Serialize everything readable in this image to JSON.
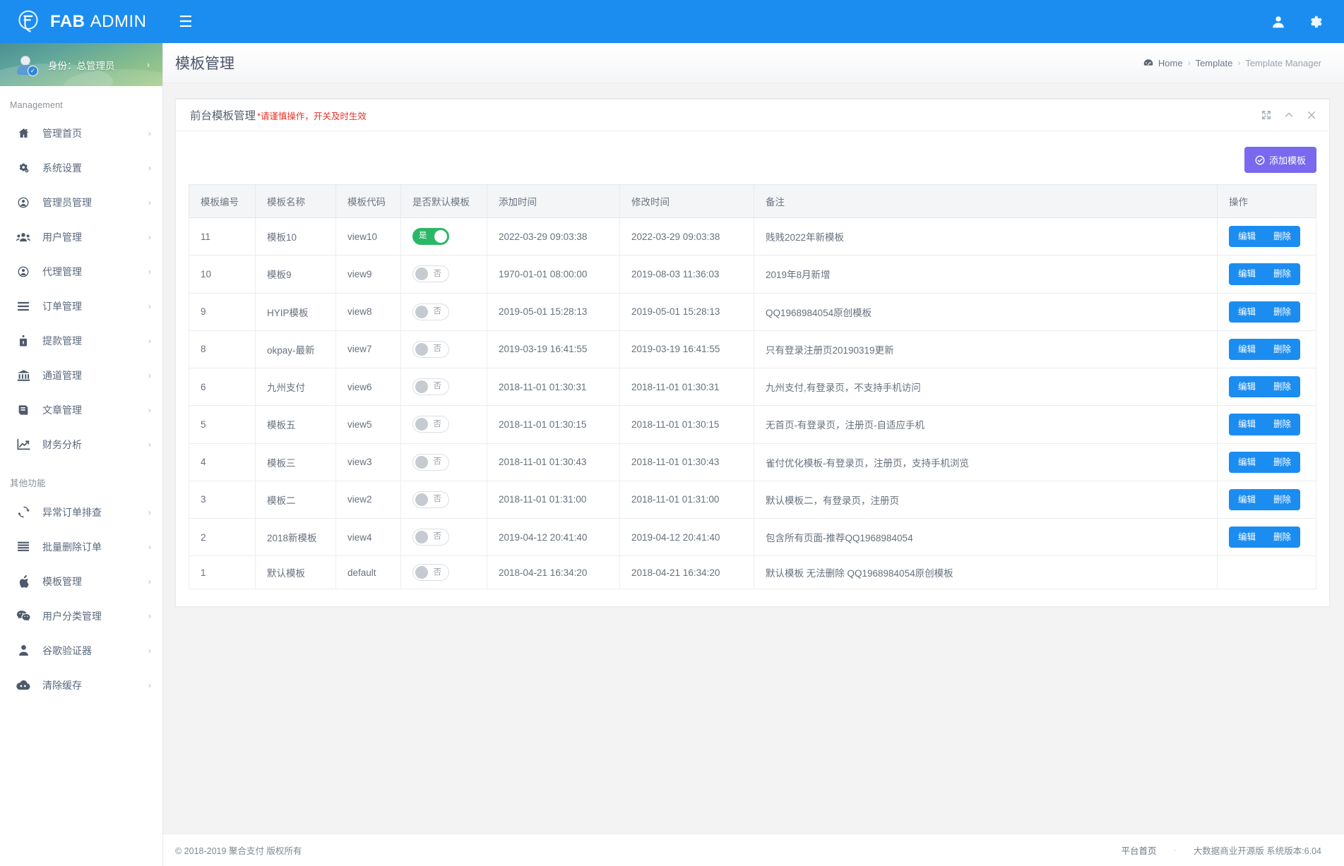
{
  "brand": {
    "bold": "FAB",
    "light": "ADMIN",
    "logo_icon": "fab-logo-icon"
  },
  "topbar": {
    "menu_toggle_icon": "hamburger-icon",
    "user_icon": "user-icon",
    "settings_icon": "gear-icon"
  },
  "sidebar": {
    "profile": {
      "label": "身份：总管理员",
      "avatar_icon": "avatar-icon",
      "check_icon": "check-badge-icon",
      "caret": "›"
    },
    "sections": [
      {
        "title": "Management",
        "items": [
          {
            "label": "管理首页",
            "icon": "home-icon",
            "caret": "›"
          },
          {
            "label": "系统设置",
            "icon": "gears-icon",
            "caret": "›"
          },
          {
            "label": "管理员管理",
            "icon": "user-circle-icon",
            "caret": "›"
          },
          {
            "label": "用户管理",
            "icon": "users-icon",
            "caret": "›"
          },
          {
            "label": "代理管理",
            "icon": "user-circle-icon",
            "caret": "›"
          },
          {
            "label": "订单管理",
            "icon": "list-icon",
            "caret": "›"
          },
          {
            "label": "提款管理",
            "icon": "lock-icon",
            "caret": "›"
          },
          {
            "label": "通道管理",
            "icon": "bank-icon",
            "caret": "›"
          },
          {
            "label": "文章管理",
            "icon": "book-icon",
            "caret": "›"
          },
          {
            "label": "财务分析",
            "icon": "chart-line-icon",
            "caret": "›"
          }
        ]
      },
      {
        "title": "其他功能",
        "items": [
          {
            "label": "异常订单排查",
            "icon": "refresh-icon",
            "caret": "›"
          },
          {
            "label": "批量删除订单",
            "icon": "list-icon",
            "caret": "›"
          },
          {
            "label": "模板管理",
            "icon": "apple-icon",
            "caret": "›"
          },
          {
            "label": "用户分类管理",
            "icon": "wechat-icon",
            "caret": "›"
          },
          {
            "label": "谷歌验证器",
            "icon": "user-solid-icon",
            "caret": "›"
          },
          {
            "label": "清除缓存",
            "icon": "cloud-icon",
            "caret": "›"
          }
        ]
      }
    ]
  },
  "page": {
    "title": "模板管理",
    "breadcrumb": {
      "home_icon": "dashboard-icon",
      "items": [
        "Home",
        "Template",
        "Template Manager"
      ],
      "separator": "›"
    }
  },
  "panel": {
    "title": "前台模板管理",
    "warning": "*请谨慎操作，开关及时生效",
    "tools": [
      {
        "name": "expand-icon"
      },
      {
        "name": "collapse-icon"
      },
      {
        "name": "close-icon"
      }
    ],
    "add_button": {
      "label": "添加模板",
      "icon": "check-circle-icon",
      "color": "#7a68ee"
    }
  },
  "table": {
    "columns": [
      "模板编号",
      "模板名称",
      "模板代码",
      "是否默认模板",
      "添加时间",
      "修改时间",
      "备注",
      "操作"
    ],
    "toggle_on_label": "是",
    "toggle_off_label": "否",
    "toggle_on_color": "#2ab867",
    "actions": {
      "edit": "编辑",
      "delete": "删除",
      "color": "#1b8df1"
    },
    "rows": [
      {
        "id": "11",
        "name": "模板10",
        "code": "view10",
        "is_default": true,
        "added": "2022-03-29 09:03:38",
        "modified": "2022-03-29 09:03:38",
        "note": "贱贱2022年新模板",
        "has_actions": true
      },
      {
        "id": "10",
        "name": "模板9",
        "code": "view9",
        "is_default": false,
        "added": "1970-01-01 08:00:00",
        "modified": "2019-08-03 11:36:03",
        "note": "2019年8月新增",
        "has_actions": true
      },
      {
        "id": "9",
        "name": "HYIP模板",
        "code": "view8",
        "is_default": false,
        "added": "2019-05-01 15:28:13",
        "modified": "2019-05-01 15:28:13",
        "note": "QQ1968984054原创模板",
        "has_actions": true
      },
      {
        "id": "8",
        "name": "okpay-最新",
        "code": "view7",
        "is_default": false,
        "added": "2019-03-19 16:41:55",
        "modified": "2019-03-19 16:41:55",
        "note": "只有登录注册页20190319更新",
        "has_actions": true
      },
      {
        "id": "6",
        "name": "九州支付",
        "code": "view6",
        "is_default": false,
        "added": "2018-11-01 01:30:31",
        "modified": "2018-11-01 01:30:31",
        "note": "九州支付,有登录页，不支持手机访问",
        "has_actions": true
      },
      {
        "id": "5",
        "name": "模板五",
        "code": "view5",
        "is_default": false,
        "added": "2018-11-01 01:30:15",
        "modified": "2018-11-01 01:30:15",
        "note": "无首页-有登录页，注册页-自适应手机",
        "has_actions": true
      },
      {
        "id": "4",
        "name": "模板三",
        "code": "view3",
        "is_default": false,
        "added": "2018-11-01 01:30:43",
        "modified": "2018-11-01 01:30:43",
        "note": "雀付优化模板-有登录页，注册页，支持手机浏览",
        "has_actions": true
      },
      {
        "id": "3",
        "name": "模板二",
        "code": "view2",
        "is_default": false,
        "added": "2018-11-01 01:31:00",
        "modified": "2018-11-01 01:31:00",
        "note": "默认模板二，有登录页，注册页",
        "has_actions": true
      },
      {
        "id": "2",
        "name": "2018新模板",
        "code": "view4",
        "is_default": false,
        "added": "2019-04-12 20:41:40",
        "modified": "2019-04-12 20:41:40",
        "note": "包含所有页面-推荐QQ1968984054",
        "has_actions": true
      },
      {
        "id": "1",
        "name": "默认模板",
        "code": "default",
        "is_default": false,
        "added": "2018-04-21 16:34:20",
        "modified": "2018-04-21 16:34:20",
        "note": "默认模板 无法删除 QQ1968984054原创模板",
        "has_actions": false
      }
    ]
  },
  "footer": {
    "copyright": "© 2018-2019 聚合支付 版权所有",
    "home_link": "平台首页",
    "dot": "·",
    "version": "大数据商业开源版 系统版本:6.04"
  }
}
